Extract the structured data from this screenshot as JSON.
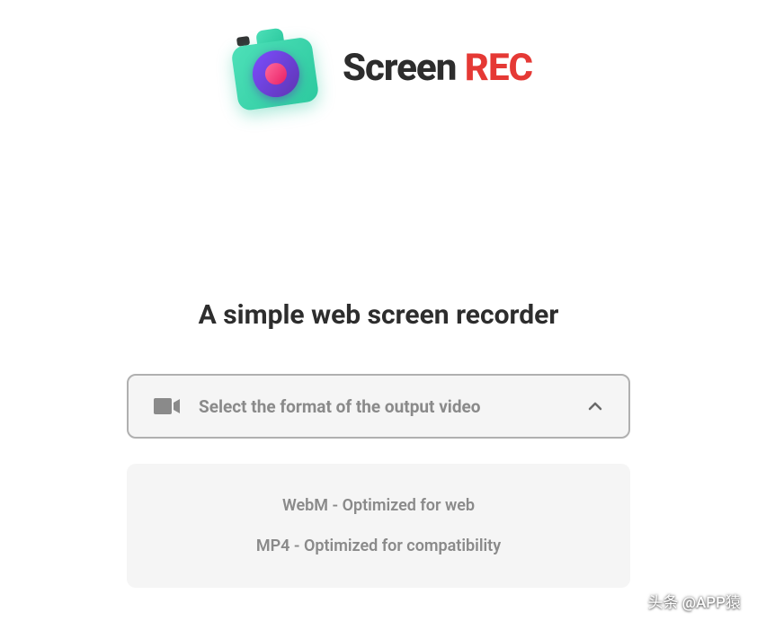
{
  "logo": {
    "text_primary": "Screen ",
    "text_accent": "REC"
  },
  "tagline": "A simple web screen recorder",
  "dropdown": {
    "label": "Select the format of the output video",
    "options": [
      "WebM - Optimized for web",
      "MP4 - Optimized for compatibility"
    ]
  },
  "watermark": "头条 @APP猿",
  "colors": {
    "accent_red": "#e53935",
    "accent_teal": "#2dc99f",
    "accent_purple": "#5e35b1",
    "text_dark": "#2d2d2d",
    "text_muted": "#8a8a8a",
    "panel_bg": "#f5f5f5"
  }
}
